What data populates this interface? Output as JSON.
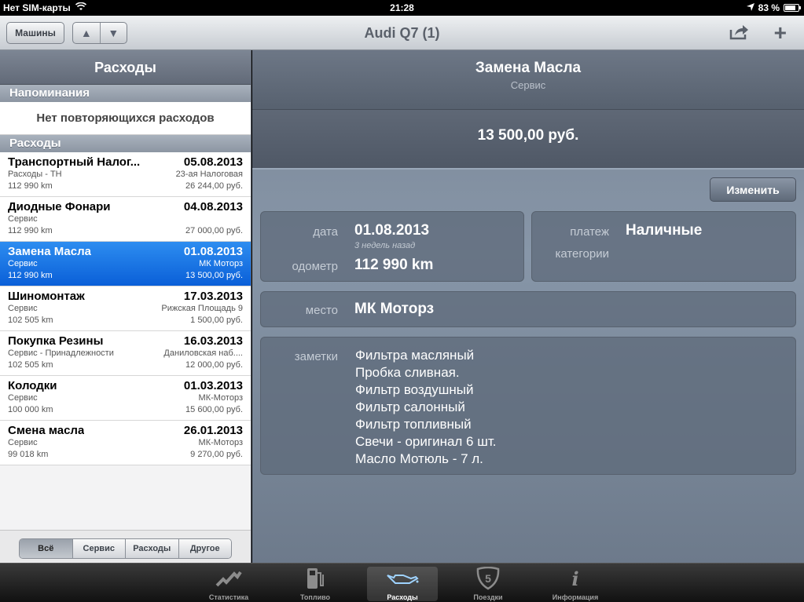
{
  "status": {
    "carrier": "Нет SIM-карты",
    "time": "21:28",
    "battery": "83 %",
    "battery_level": 0.83
  },
  "nav": {
    "cars_button": "Машины",
    "title": "Audi Q7 (1)"
  },
  "left": {
    "header": "Расходы",
    "reminders_section": "Напоминания",
    "no_recurring": "Нет повторяющихся расходов",
    "expenses_section": "Расходы",
    "items": [
      {
        "name": "Транспортный Налог...",
        "date": "05.08.2013",
        "category": "Расходы - ТН",
        "place": "23-ая Налоговая",
        "odometer": "112 990 km",
        "amount": "26 244,00 руб."
      },
      {
        "name": "Диодные Фонари",
        "date": "04.08.2013",
        "category": "Сервис",
        "place": "",
        "odometer": "112 990 km",
        "amount": "27 000,00 руб."
      },
      {
        "name": "Замена Масла",
        "date": "01.08.2013",
        "category": "Сервис",
        "place": "МК Моторз",
        "odometer": "112 990 km",
        "amount": "13 500,00 руб."
      },
      {
        "name": "Шиномонтаж",
        "date": "17.03.2013",
        "category": "Сервис",
        "place": "Рижская Площадь 9",
        "odometer": "102 505 km",
        "amount": "1 500,00 руб."
      },
      {
        "name": "Покупка Резины",
        "date": "16.03.2013",
        "category": "Сервис - Принадлежности",
        "place": "Даниловская наб....",
        "odometer": "102 505 km",
        "amount": "12 000,00 руб."
      },
      {
        "name": "Колодки",
        "date": "01.03.2013",
        "category": "Сервис",
        "place": "МК-Моторз",
        "odometer": "100 000 km",
        "amount": "15 600,00 руб."
      },
      {
        "name": "Смена масла",
        "date": "26.01.2013",
        "category": "Сервис",
        "place": "МК-Моторз",
        "odometer": "99 018 km",
        "amount": "9 270,00 руб."
      }
    ],
    "filter": [
      "Всё",
      "Сервис",
      "Расходы",
      "Другое"
    ]
  },
  "detail": {
    "title": "Замена Масла",
    "subtitle": "Сервис",
    "price": "13 500,00 руб.",
    "edit_button": "Изменить",
    "date_label": "дата",
    "date_value": "01.08.2013",
    "date_ago": "3 недель назад",
    "odometer_label": "одометр",
    "odometer_value": "112 990 km",
    "payment_label": "платеж",
    "payment_value": "Наличные",
    "categories_label": "категории",
    "place_label": "место",
    "place_value": "МК Моторз",
    "notes_label": "заметки",
    "notes": [
      "Фильтра масляный",
      "Пробка сливная.",
      "Фильтр воздушный",
      "Фильтр салонный",
      "Фильтр топливный",
      "Свечи - оригинал 6 шт.",
      "Масло Мотюль - 7 л."
    ]
  },
  "tabs": [
    {
      "label": "Статистика",
      "icon": "chart-icon"
    },
    {
      "label": "Топливо",
      "icon": "fuel-pump-icon"
    },
    {
      "label": "Расходы",
      "icon": "oil-can-icon"
    },
    {
      "label": "Поездки",
      "icon": "route-shield-icon"
    },
    {
      "label": "Информация",
      "icon": "info-icon"
    }
  ],
  "colors": {
    "selected_row": "#0a5fd8",
    "detail_bg": "#7b8797"
  }
}
